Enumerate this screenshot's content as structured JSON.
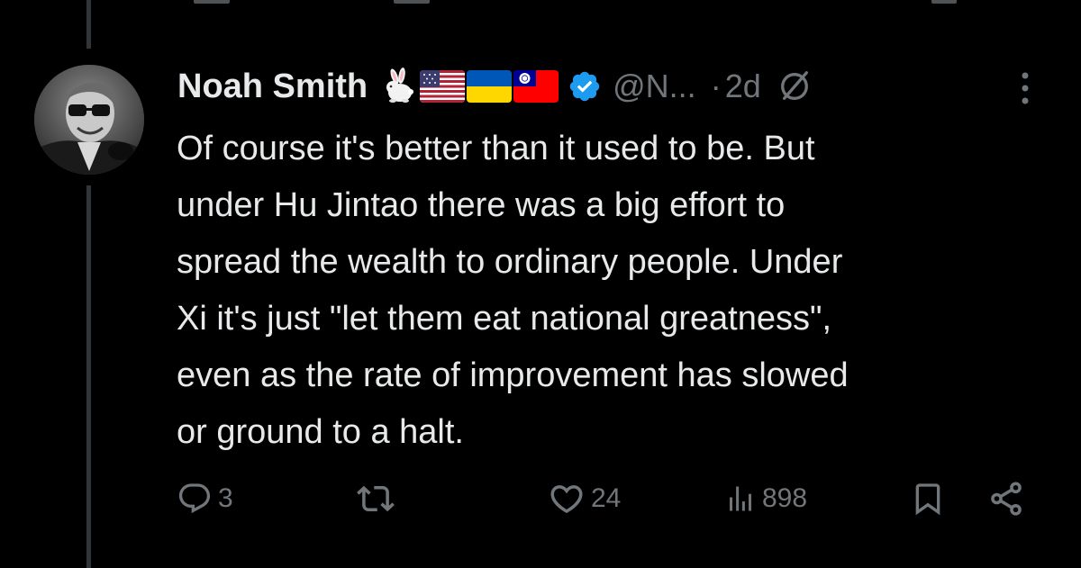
{
  "tweet": {
    "author": {
      "display_name": "Noah Smith",
      "handle": "@N...",
      "name_emojis": [
        "rabbit-emoji",
        "us-flag",
        "ukraine-flag",
        "taiwan-flag"
      ],
      "verified": true
    },
    "separator": "·",
    "timestamp": "2d",
    "text": "Of course it's better than it used to be. But\nunder Hu Jintao there was a big effort to\nspread the wealth to ordinary people. Under\nXi it's just \"let them eat national greatness\",\neven as the rate of improvement has slowed\nor ground to a halt.",
    "actions": {
      "replies": "3",
      "reposts": "",
      "likes": "24",
      "views": "898"
    }
  },
  "colors": {
    "background": "#000000",
    "text_primary": "#e7e9ea",
    "text_secondary": "#71767b",
    "verified_blue": "#1d9bf0",
    "thread_line": "#333639"
  }
}
